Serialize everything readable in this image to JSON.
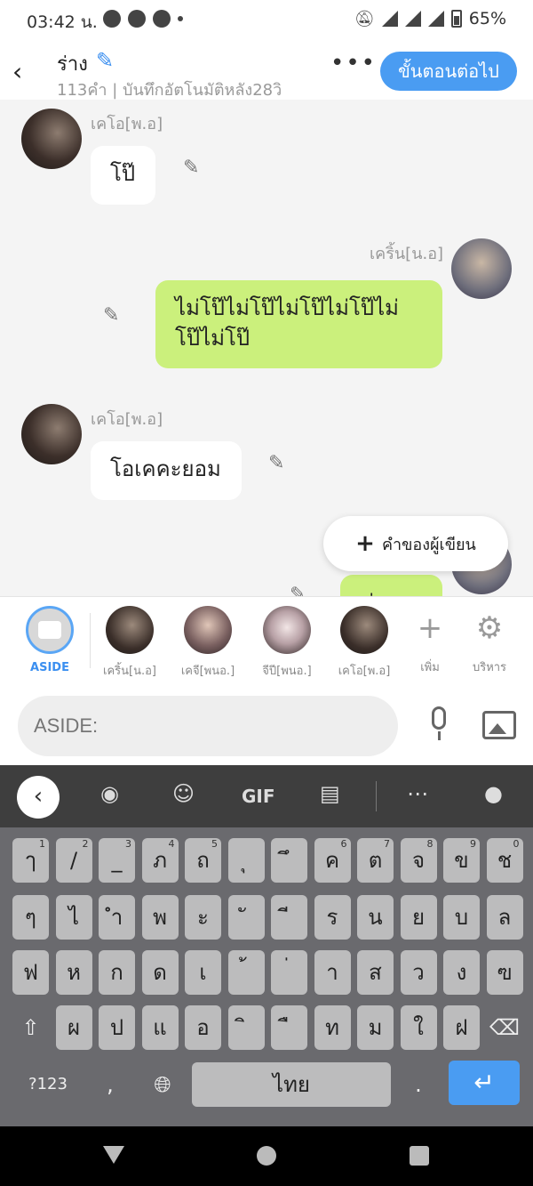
{
  "status": {
    "time": "03:42 น.",
    "battery": "65%"
  },
  "header": {
    "title": "ร่าง",
    "subtitle": "113คำ | บันทึกอัตโนมัติหลัง28วิ",
    "more": "•••",
    "next_label": "ขั้นตอนต่อไป"
  },
  "messages": [
    {
      "sender": "เคโอ[พ.อ]",
      "text": "โป๊",
      "side": "left"
    },
    {
      "sender": "เคริ้น[น.อ]",
      "text": "ไม่โป๊ไม่โป๊ไม่โป๊ไม่โป๊ไม่โป๊ไม่โป๊",
      "side": "right"
    },
    {
      "sender": "เคโอ[พ.อ]",
      "text": "โอเคคะยอม",
      "side": "left"
    },
    {
      "sender": "",
      "text": "ค่ะ",
      "side": "right"
    }
  ],
  "writer_button": "คำของผู้เขียน",
  "characters": [
    {
      "label": "ASIDE",
      "active": true
    },
    {
      "label": "เคริ้น[น.อ]"
    },
    {
      "label": "เคจี[พนอ.]"
    },
    {
      "label": "จีปี[พนอ.]"
    },
    {
      "label": "เคโอ[พ.อ]"
    }
  ],
  "tools": {
    "add": "เพิ่ม",
    "manage": "บริหาร"
  },
  "input": {
    "placeholder": "ASIDE:"
  },
  "keyboard": {
    "toolbar": {
      "gif": "GIF"
    },
    "row1": [
      [
        "ๅ",
        "1"
      ],
      [
        "/",
        "2"
      ],
      [
        "_",
        "3"
      ],
      [
        "ภ",
        "4"
      ],
      [
        "ถ",
        "5"
      ],
      [
        "ุ",
        ""
      ],
      [
        "ึ",
        ""
      ],
      [
        "ค",
        "6"
      ],
      [
        "ต",
        "7"
      ],
      [
        "จ",
        "8"
      ],
      [
        "ข",
        "9"
      ],
      [
        "ช",
        "0"
      ]
    ],
    "row2": [
      "ๆ",
      "ไ",
      "ำ",
      "พ",
      "ะ",
      "ั",
      "ี",
      "ร",
      "น",
      "ย",
      "บ",
      "ล"
    ],
    "row3": [
      "ฟ",
      "ห",
      "ก",
      "ด",
      "เ",
      "้",
      "่",
      "า",
      "ส",
      "ว",
      "ง",
      "ฃ"
    ],
    "row4": [
      "ผ",
      "ป",
      "แ",
      "อ",
      "ิ",
      "ื",
      "ท",
      "ม",
      "ใ",
      "ฝ"
    ],
    "numbers_label": "?123",
    "emoji_label": "☺",
    "comma": ",",
    "space_label": "ไทย",
    "period": "."
  }
}
